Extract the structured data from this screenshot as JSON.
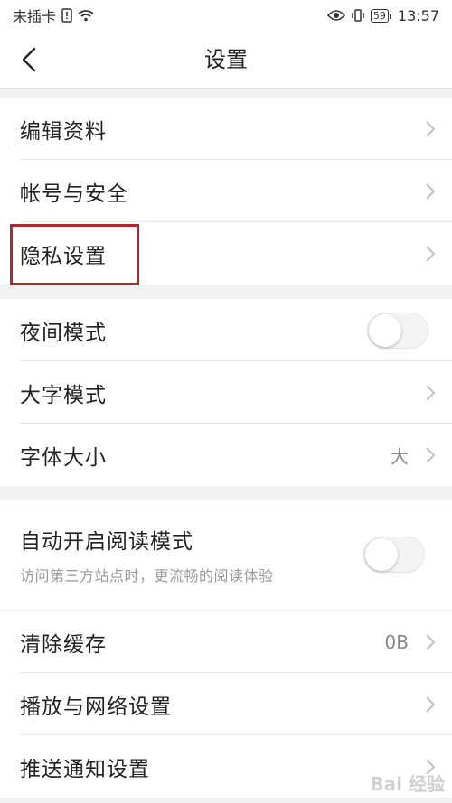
{
  "status_bar": {
    "carrier": "未插卡",
    "battery": "59",
    "time": "13:57"
  },
  "header": {
    "title": "设置"
  },
  "groups": [
    {
      "items": [
        {
          "label": "编辑资料"
        },
        {
          "label": "帐号与安全"
        },
        {
          "label": "隐私设置",
          "highlighted": true
        }
      ]
    },
    {
      "items": [
        {
          "label": "夜间模式",
          "toggle": false
        },
        {
          "label": "大字模式"
        },
        {
          "label": "字体大小",
          "value": "大"
        }
      ]
    },
    {
      "items": [
        {
          "label": "自动开启阅读模式",
          "sublabel": "访问第三方站点时，更流畅的阅读体验",
          "toggle": false
        }
      ]
    },
    {
      "items": [
        {
          "label": "清除缓存",
          "value": "0B"
        },
        {
          "label": "播放与网络设置"
        },
        {
          "label": "推送通知设置"
        }
      ]
    }
  ],
  "watermark": "Bai 经验",
  "colors": {
    "highlight_border": "#b3262a",
    "background": "#f2f2f2"
  }
}
